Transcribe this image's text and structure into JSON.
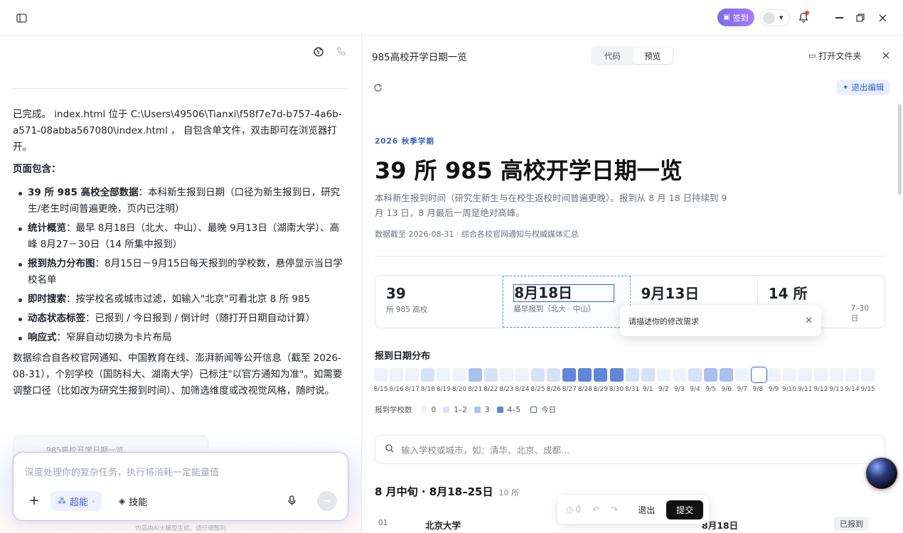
{
  "topbar": {
    "signin_label": "签到"
  },
  "chat": {
    "p1": "已完成。 index.html  位于  C:\\Users\\49506\\Tianxi\\f58f7e7d-b757-4a6b-a571-08abba567080\\index.html ， 自包含单文件，双击即可在浏览器打开。",
    "p2_heading": "页面包含：",
    "items": [
      {
        "bold": "39 所 985 高校全部数据",
        "text": "：本科新生报到日期（口径为新生报到日，研究生/老生时间普遍更晚，页内已注明）"
      },
      {
        "bold": "统计概览",
        "text": "：最早 8月18日（北大、中山）、最晚 9月13日（湖南大学）、高峰 8月27－30日（14 所集中报到）"
      },
      {
        "bold": "报到热力分布图",
        "text": "：8月15日－9月15日每天报到的学校数，悬停显示当日学校名单"
      },
      {
        "bold": "即时搜索",
        "text": "：按学校名或城市过滤，如输入\"北京\"可看北京 8 所 985"
      },
      {
        "bold": "动态状态标签",
        "text": "：已报到 / 今日报到 / 倒计时（随打开日期自动计算）"
      },
      {
        "bold": "响应式",
        "text": "：窄屏自动切换为卡片布局"
      }
    ],
    "p3": "数据综合自各校官网通知、中国教育在线、澎湃新闻等公开信息（截至 2026-08-31），个别学校（国防科大、湖南大学）已标注\"以官方通知为准\"。如需要调整口径（比如改为研究生报到时间）、加筛选维度或改视觉风格，随时说。",
    "peek_card": "985高校开学日期一览"
  },
  "composer": {
    "placeholder": "深度处理你的复杂任务，执行将消耗一定能量值",
    "mode_label": "超能",
    "skill_label": "技能",
    "disclaimer": "内容由AI大模型生成，请仔细甄别"
  },
  "preview_header": {
    "title": "985高校开学日期一览",
    "tab_code": "代码",
    "tab_preview": "预览",
    "open_folder": "打开文件夹",
    "exit_edit": "退出编辑"
  },
  "page": {
    "eyebrow": "2026 秋季学期",
    "title": "39 所 985 高校开学日期一览",
    "subtitle": "本科新生报到时间（研究生新生与在校生返校时间普遍更晚）。报到从 8 月 18 日持续到 9 月 13 日，8 月最后一周是绝对高峰。",
    "source": "数据截至 2026-08-31 · 综合各校官网通知与权威媒体汇总",
    "stats": [
      {
        "value": "39",
        "label": "所 985 高校"
      },
      {
        "value": "8月18日",
        "label": "最早报到（北大 · 中山）"
      },
      {
        "value": "9月13日",
        "label": ""
      },
      {
        "value": "14 所",
        "label": "7–30日"
      }
    ],
    "heat_title": "报到日期分布",
    "legend": {
      "title": "报到学校数",
      "l0": "0",
      "l1": "1–2",
      "l2": "3",
      "l3": "4–5",
      "today": "今日"
    },
    "search_placeholder": "输入学校或城市，如：清华、北京、成都...",
    "section_title": "8 月中旬 · 8月18–25日",
    "section_count": "10 所",
    "first_row": {
      "index": "01",
      "name": "北京大学",
      "date": "8月18日",
      "status": "已报到"
    }
  },
  "heat_levels": [
    0,
    0,
    0,
    1,
    0,
    0,
    2,
    1,
    0,
    0,
    1,
    1,
    3,
    3,
    3,
    3,
    1,
    1,
    0,
    0,
    1,
    2,
    2,
    0,
    0,
    0,
    0,
    0,
    0,
    0,
    0,
    0
  ],
  "heat_dates": [
    "8/15",
    "8/16",
    "8/17",
    "8/18",
    "8/19",
    "8/20",
    "8/21",
    "8/22",
    "8/23",
    "8/24",
    "8/25",
    "8/26",
    "8/27",
    "8/28",
    "8/29",
    "8/30",
    "8/31",
    "9/1",
    "9/2",
    "9/3",
    "9/4",
    "9/5",
    "9/6",
    "9/7",
    "9/8",
    "9/9",
    "9/10",
    "9/11",
    "9/12",
    "9/13",
    "9/14",
    "9/15"
  ],
  "today_date": "9/8",
  "popup": {
    "placeholder": "请描述你的修改需求"
  },
  "toolbar": {
    "count": "0",
    "exit": "退出",
    "submit": "提交"
  },
  "colors": {
    "accent": "#3b63c4",
    "level0": "#eef2fa",
    "level1": "#d6e2f7",
    "level2": "#a9c1ee",
    "level3": "#5f87d6",
    "signin": "#8a6cf2"
  }
}
